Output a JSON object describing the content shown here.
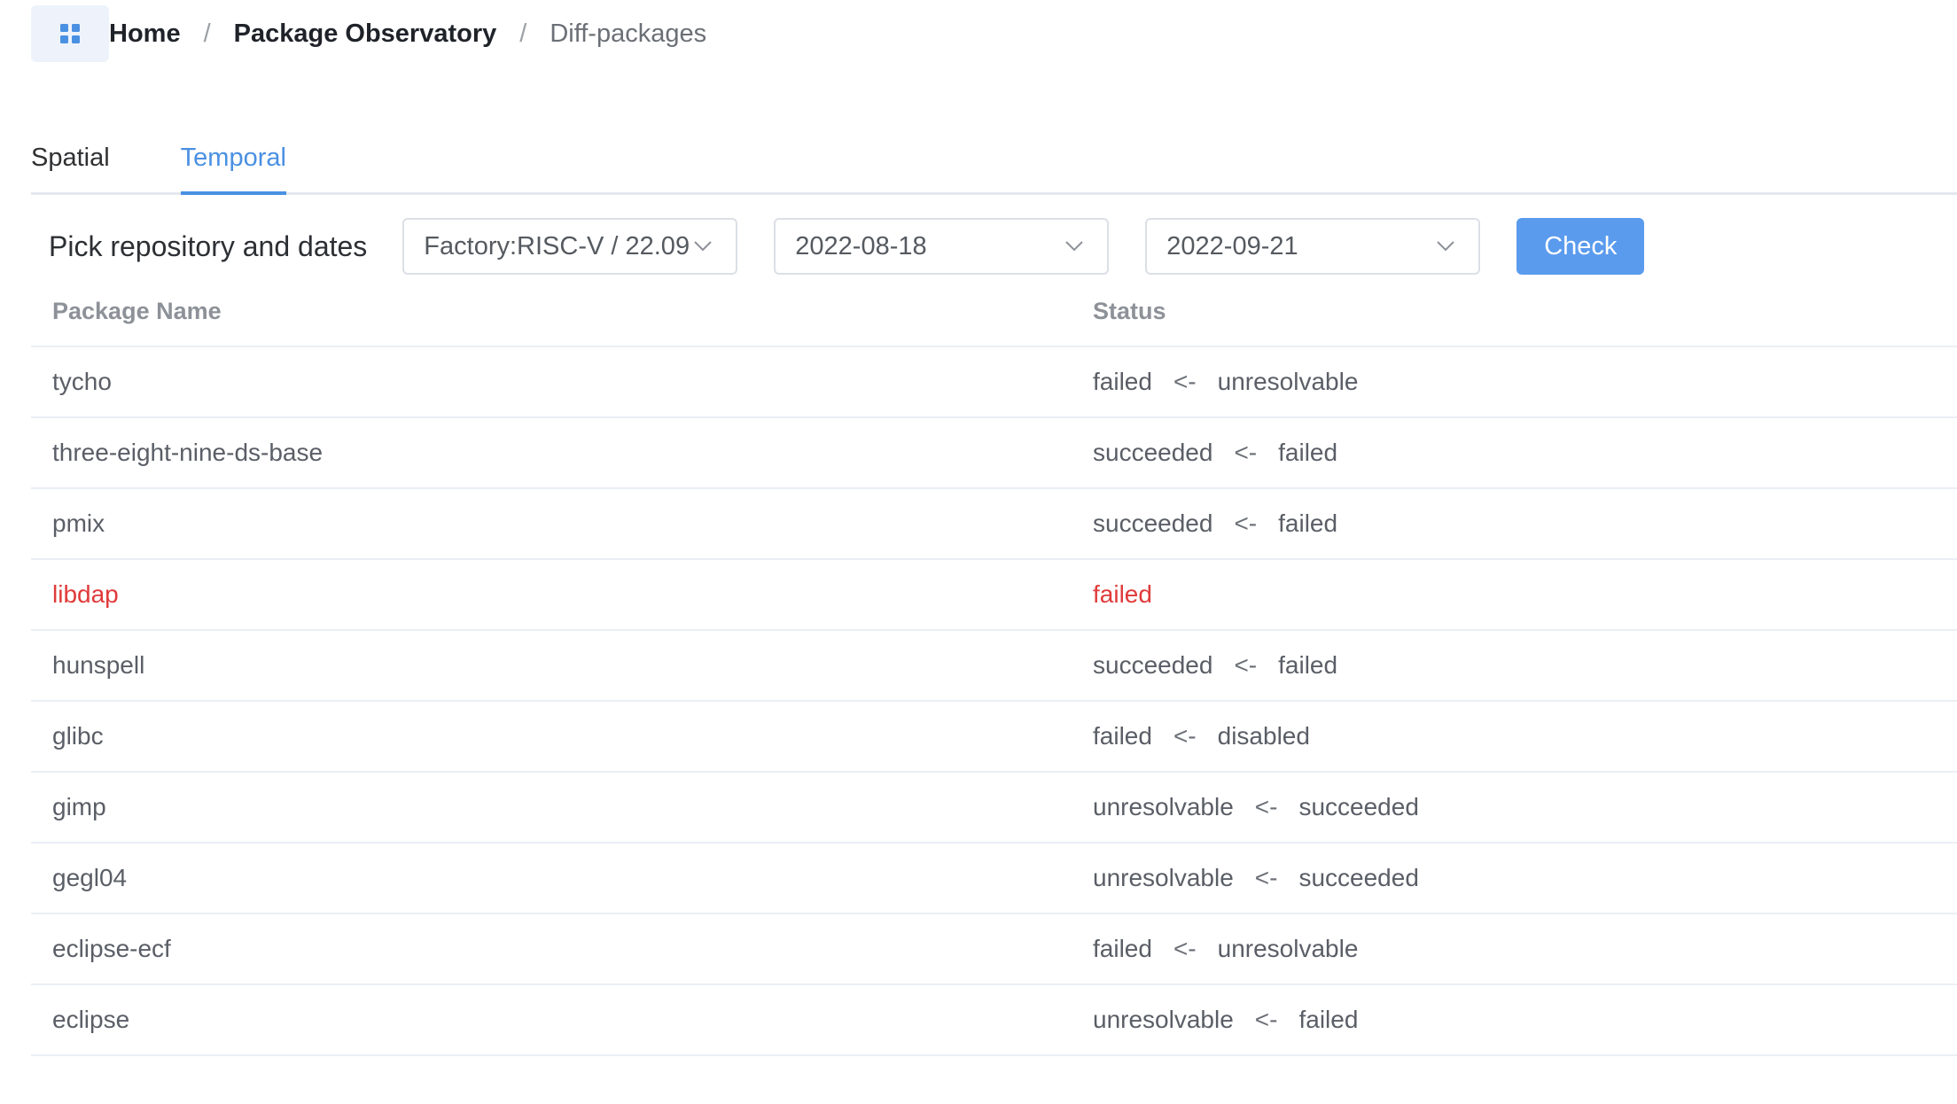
{
  "breadcrumb": {
    "icon": "grid-icon",
    "items": [
      "Home",
      "Package Observatory",
      "Diff-packages"
    ]
  },
  "tabs": [
    {
      "label": "Spatial",
      "active": false
    },
    {
      "label": "Temporal",
      "active": true
    }
  ],
  "controls": {
    "label": "Pick repository and dates",
    "repository": "Factory:RISC-V / 22.09",
    "date_from": "2022-08-18",
    "date_to": "2022-09-21",
    "check_label": "Check"
  },
  "table": {
    "headers": {
      "name": "Package Name",
      "status": "Status"
    },
    "arrow": "<-",
    "rows": [
      {
        "name": "tycho",
        "new": "failed",
        "old": "unresolvable"
      },
      {
        "name": "three-eight-nine-ds-base",
        "new": "succeeded",
        "old": "failed"
      },
      {
        "name": "pmix",
        "new": "succeeded",
        "old": "failed"
      },
      {
        "name": "libdap",
        "new": "failed",
        "old": null,
        "highlight": true
      },
      {
        "name": "hunspell",
        "new": "succeeded",
        "old": "failed"
      },
      {
        "name": "glibc",
        "new": "failed",
        "old": "disabled"
      },
      {
        "name": "gimp",
        "new": "unresolvable",
        "old": "succeeded"
      },
      {
        "name": "gegl04",
        "new": "unresolvable",
        "old": "succeeded"
      },
      {
        "name": "eclipse-ecf",
        "new": "failed",
        "old": "unresolvable"
      },
      {
        "name": "eclipse",
        "new": "unresolvable",
        "old": "failed"
      }
    ]
  },
  "colors": {
    "accent": "#4a90e2",
    "button": "#5a9bee",
    "error": "#e03a3a"
  }
}
